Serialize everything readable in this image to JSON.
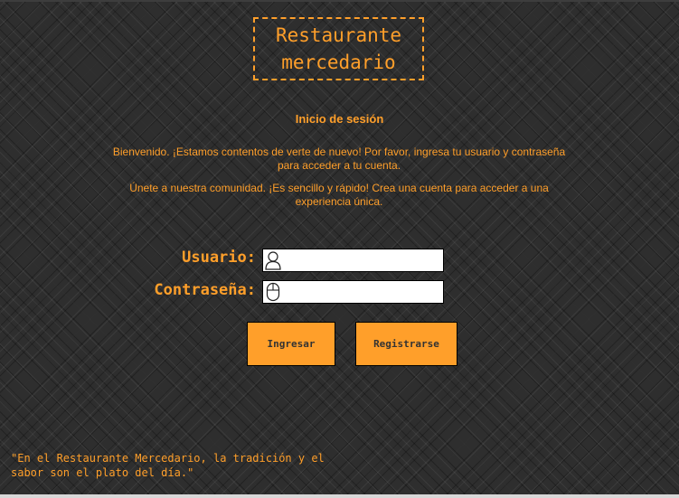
{
  "header": {
    "logo_text": "Restaurante\nmercedario"
  },
  "login": {
    "title": "Inicio de sesión",
    "welcome_text": "Bienvenido. ¡Estamos contentos de verte de nuevo! Por favor, ingresa tu usuario y contraseña para acceder a tu cuenta.",
    "join_text": "Únete a nuestra comunidad. ¡Es sencillo y rápido! Crea una cuenta para acceder a una experiencia única.",
    "username_label": "Usuario:",
    "username_value": "",
    "password_label": "Contraseña:",
    "password_value": "",
    "login_button": "Ingresar",
    "register_button": "Registrarse"
  },
  "icons": {
    "username": "user-icon",
    "password": "mouse-icon"
  },
  "footer": {
    "quote": "\"En el Restaurante Mercedario, la tradición y el\nsabor son el plato del día.\""
  },
  "colors": {
    "accent": "#ff9f2a",
    "background": "#2e2e2e"
  }
}
